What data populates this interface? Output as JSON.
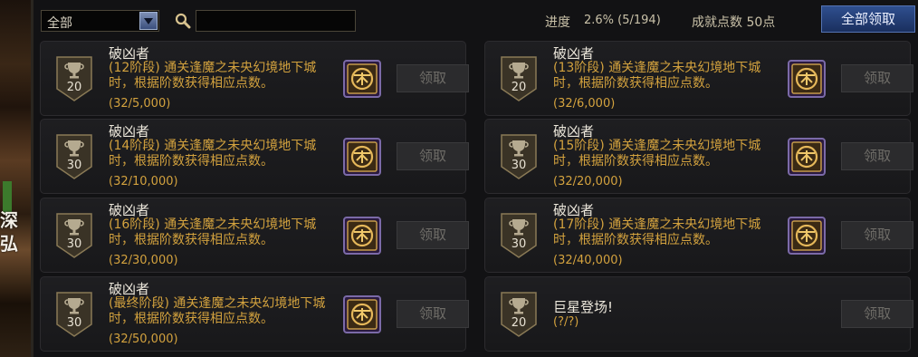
{
  "left_strip": {
    "glyph_1": "深",
    "glyph_2": "弘"
  },
  "filter": {
    "selected": "全部",
    "arrow_icon": "chevron-down-icon"
  },
  "search": {
    "icon": "search-icon",
    "value": ""
  },
  "progress": {
    "label": "进度",
    "value": "2.6% (5/194)"
  },
  "points": {
    "label": "成就点数 50点"
  },
  "claim_all": {
    "label": "全部领取"
  },
  "cards": [
    {
      "title": "破凶者",
      "desc": "(12阶段) 通关逢魔之未央幻境地下城时，根据阶数获得相应点数。",
      "count": "(32/5,000)",
      "points": "20",
      "claim": "领取"
    },
    {
      "title": "破凶者",
      "desc": "(13阶段) 通关逢魔之未央幻境地下城时，根据阶数获得相应点数。",
      "count": "(32/6,000)",
      "points": "20",
      "claim": "领取"
    },
    {
      "title": "破凶者",
      "desc": "(14阶段) 通关逢魔之未央幻境地下城时，根据阶数获得相应点数。",
      "count": "(32/10,000)",
      "points": "30",
      "claim": "领取"
    },
    {
      "title": "破凶者",
      "desc": "(15阶段) 通关逢魔之未央幻境地下城时，根据阶数获得相应点数。",
      "count": "(32/20,000)",
      "points": "30",
      "claim": "领取"
    },
    {
      "title": "破凶者",
      "desc": "(16阶段) 通关逢魔之未央幻境地下城时，根据阶数获得相应点数。",
      "count": "(32/30,000)",
      "points": "30",
      "claim": "领取"
    },
    {
      "title": "破凶者",
      "desc": "(17阶段) 通关逢魔之未央幻境地下城时，根据阶数获得相应点数。",
      "count": "(32/40,000)",
      "points": "30",
      "claim": "领取"
    },
    {
      "title": "破凶者",
      "desc": "(最终阶段) 通关逢魔之未央幻境地下城时，根据阶数获得相应点数。",
      "count": "(32/50,000)",
      "points": "30",
      "claim": "领取"
    },
    {
      "title": "巨星登场!",
      "desc": "",
      "count": "(?/?)",
      "points": "20",
      "claim": "领取"
    }
  ]
}
